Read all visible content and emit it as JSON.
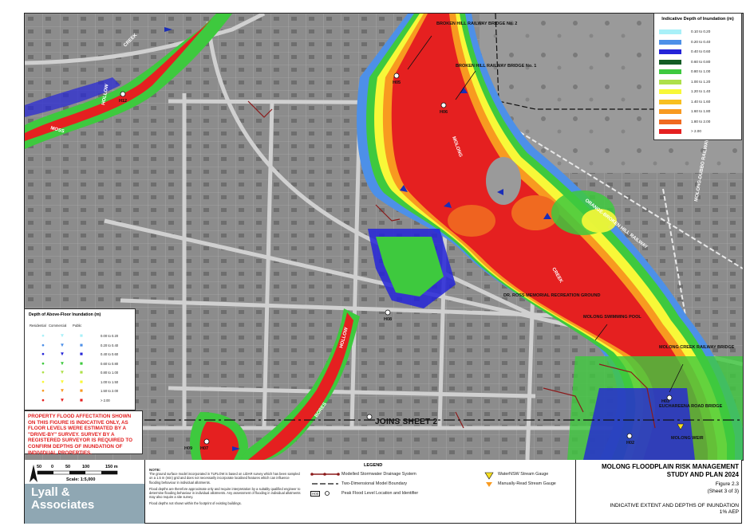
{
  "depth_legend": {
    "title": "Indicative Depth of Inundation (m)",
    "rows": [
      {
        "label": "0.10 to 0.20",
        "color": "#a8f0f8"
      },
      {
        "label": "0.20 to 0.40",
        "color": "#4d90e8"
      },
      {
        "label": "0.40 to 0.60",
        "color": "#2424d8"
      },
      {
        "label": "0.60 to 0.80",
        "color": "#125c24"
      },
      {
        "label": "0.80 to 1.00",
        "color": "#3ec93e"
      },
      {
        "label": "1.00 to 1.20",
        "color": "#aee04a"
      },
      {
        "label": "1.20 to 1.40",
        "color": "#f8f838"
      },
      {
        "label": "1.40 to 1.60",
        "color": "#f8c020"
      },
      {
        "label": "1.60 to 1.80",
        "color": "#f89a20"
      },
      {
        "label": "1.80 to 2.00",
        "color": "#f06a20"
      },
      {
        "label": "> 2.00",
        "color": "#e52020"
      }
    ]
  },
  "floor_legend": {
    "title": "Depth of Above-Floor Inundation (m)",
    "col_residential": "Residential",
    "col_commercial": "Commercial",
    "col_public": "Public",
    "rows": [
      {
        "label": "0.00 to 0.20",
        "color": "#a8f0f8"
      },
      {
        "label": "0.20 to 0.40",
        "color": "#4d90e8"
      },
      {
        "label": "0.40 to 0.60",
        "color": "#2424d8"
      },
      {
        "label": "0.60 to 0.80",
        "color": "#3ec93e"
      },
      {
        "label": "0.80 to 1.00",
        "color": "#aee04a"
      },
      {
        "label": "1.00 to 1.50",
        "color": "#f8f838"
      },
      {
        "label": "1.50 to 2.00",
        "color": "#f89a20"
      },
      {
        "label": "> 2.00",
        "color": "#e52020"
      }
    ]
  },
  "warning": "PROPERTY FLOOD AFFECTATION SHOWN ON THIS FIGURE IS INDICATIVE ONLY, AS FLOOR LEVELS WERE ESTIMATED BY A \"DRIVE-BY\" SURVEY. SURVEY BY A REGISTERED SURVEYOR IS REQUIRED TO CONFIRM DEPTHS OF INUNDATION OF INDIVIDUAL PROPERTIES.",
  "joins": "JOINS SHEET 2",
  "map_labels": {
    "broken_hill_bridge_2": "BROKEN HILL RAILWAY BRIDGE No. 2",
    "broken_hill_bridge_1": "BROKEN HILL RAILWAY BRIDGE No. 1",
    "molong_creek_1": "MOLONG",
    "molong_creek_2": "CREEK",
    "creek_top": "CREEK",
    "hollow_top": "HOLLOW",
    "moss": "MOSS",
    "hollow_mid": "HOLLOW",
    "bores": "BORES",
    "orange_railway": "ORANGE-BROKEN HILL RAILWAY",
    "molong_dubbo_railway": "MOLONG-DUBBO RAILWAY",
    "dr_ross": "DR. ROSS MEMORIAL RECREATION GROUND",
    "swimming_pool": "MOLONG SWIMMING POOL",
    "creek_rail_bridge": "MOLONG CREEK RAILWAY BRIDGE",
    "euchareena": "EUCHAREENA ROAD BRIDGE",
    "weir": "MOLONG WEIR",
    "h05": "H05",
    "h06": "H06",
    "h12": "H12",
    "h08": "H08",
    "h03": "H03",
    "h02": "H02",
    "h07": "H07",
    "h09": "H09"
  },
  "scale": {
    "ticks": [
      "50",
      "0",
      "50",
      "100",
      "150 m"
    ],
    "text": "Scale: 1:5,000"
  },
  "logo": {
    "line1": "Lyall &",
    "line2": "Associates"
  },
  "notes": {
    "heading": "NOTE:",
    "p1": "The ground surface model incorporated in TUFLOW is based on LiDAR survey which has been sampled on a 1.5 m (min) grid and does not necessarily incorporate localised features which can influence flooding behaviour in individual allotments.",
    "p2": "Flood depths are therefore approximate only and require interpretation by a suitably qualified engineer to determine flooding behaviour in individual allotments. Any assessment of flooding in individual allotments may also require a site survey.",
    "p3": "Flood depths not shown within the footprint of existing buildings."
  },
  "legend": {
    "title": "LEGEND",
    "stormwater": "Modelled Stormwater Drainage System",
    "boundary": "Two-Dimensional Model Boundary",
    "peak": "Peak Flood Level Location and Identifier",
    "peak_code": "H00",
    "waternsw": "WaterNSW Stream Gauge",
    "manual": "Manually-Read Stream Gauge"
  },
  "title_block": {
    "line1": "MOLONG FLOODPLAIN RISK MANAGEMENT",
    "line2": "STUDY AND PLAN 2024",
    "figure": "Figure 2.3",
    "sheet": "(Sheet 3 of 3)",
    "line3": "INDICATIVE EXTENT AND DEPTHS OF INUNDATION",
    "line4": "1% AEP"
  }
}
